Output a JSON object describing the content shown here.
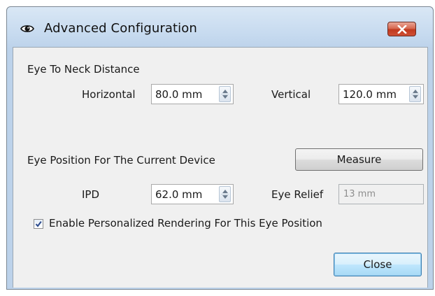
{
  "window": {
    "title": "Advanced Configuration",
    "close_icon": "close-icon",
    "title_icon": "eye-icon"
  },
  "eye_to_neck": {
    "heading": "Eye To Neck Distance",
    "horizontal_label": "Horizontal",
    "horizontal_value": "80.0 mm",
    "vertical_label": "Vertical",
    "vertical_value": "120.0 mm"
  },
  "eye_position": {
    "heading": "Eye Position For The Current Device",
    "measure_label": "Measure",
    "ipd_label": "IPD",
    "ipd_value": "62.0 mm",
    "eye_relief_label": "Eye Relief",
    "eye_relief_value": "13 mm"
  },
  "personalized": {
    "label": "Enable Personalized Rendering For This Eye Position",
    "checked": true
  },
  "footer": {
    "close_label": "Close"
  },
  "colors": {
    "title_gradient": "#c6daef",
    "close_red": "#c0391e",
    "default_button_border": "#3c7fb1",
    "client_bg": "#f0f0f0"
  }
}
